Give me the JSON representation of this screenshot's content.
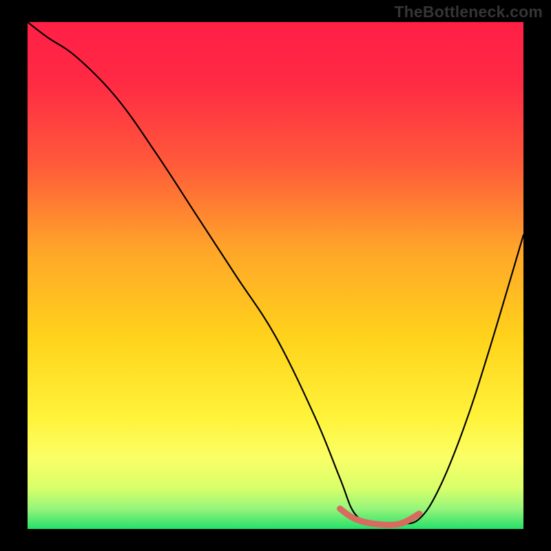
{
  "watermark": "TheBottleneck.com",
  "chart_data": {
    "type": "line",
    "title": "",
    "xlabel": "",
    "ylabel": "",
    "xlim": [
      0,
      100
    ],
    "ylim": [
      0,
      100
    ],
    "gradient_stops": [
      {
        "offset": 0.0,
        "color": "#ff1f46"
      },
      {
        "offset": 0.12,
        "color": "#ff2a44"
      },
      {
        "offset": 0.28,
        "color": "#ff5a3a"
      },
      {
        "offset": 0.45,
        "color": "#ffa629"
      },
      {
        "offset": 0.62,
        "color": "#ffd21b"
      },
      {
        "offset": 0.78,
        "color": "#fff33a"
      },
      {
        "offset": 0.86,
        "color": "#faff66"
      },
      {
        "offset": 0.92,
        "color": "#d8ff6a"
      },
      {
        "offset": 0.96,
        "color": "#96f57a"
      },
      {
        "offset": 1.0,
        "color": "#26e06a"
      }
    ],
    "series": [
      {
        "name": "bottleneck-curve",
        "x": [
          0,
          4,
          10,
          18,
          26,
          34,
          42,
          50,
          58,
          63,
          66,
          70,
          75,
          79,
          83,
          88,
          93,
          100
        ],
        "values": [
          100,
          97,
          93,
          85,
          74,
          62,
          50,
          38,
          22,
          10,
          3,
          1,
          1,
          2,
          8,
          20,
          35,
          58
        ]
      }
    ],
    "highlight": {
      "name": "optimal-range",
      "x": [
        63,
        66,
        70,
        75,
        79
      ],
      "values": [
        4,
        2,
        1,
        1,
        3
      ],
      "color": "#d86a5f"
    }
  }
}
